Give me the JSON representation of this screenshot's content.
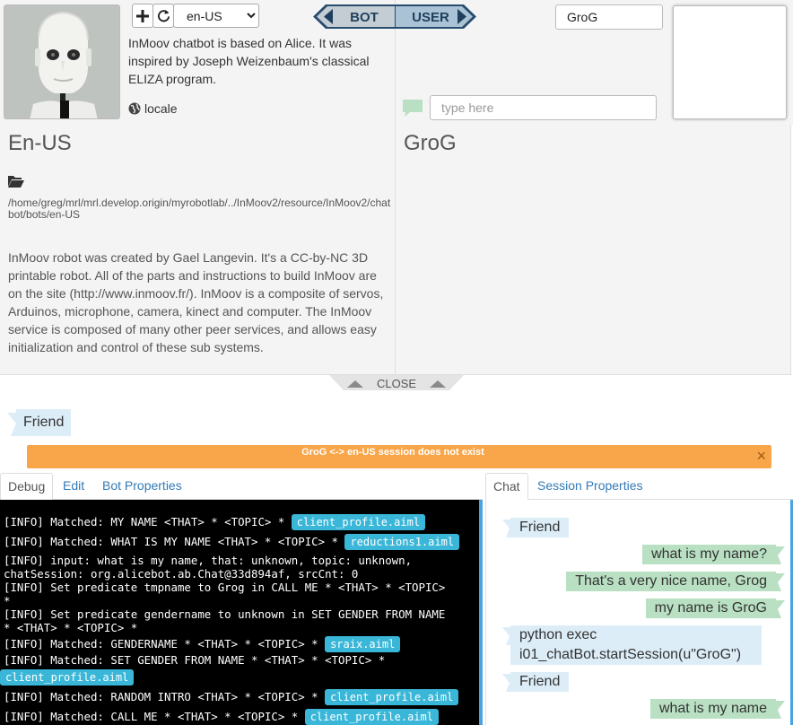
{
  "header": {
    "language_selected": "en-US",
    "bot_description": "InMoov chatbot is based on Alice. It was inspired by Joseph Weizenbaum's classical ELIZA program.",
    "locale_label": "locale",
    "toggle_bot_label": "BOT",
    "toggle_user_label": "USER",
    "user_name_value": "GroG",
    "chat_input_placeholder": "type here"
  },
  "bot_details": {
    "title": "En-US",
    "path": "/home/greg/mrl/mrl.develop.origin/myrobotlab/../InMoov2/resource/InMoov2/chatbot/bots/en-US",
    "about": "InMoov robot was created by Gael Langevin. It's a CC-by-NC 3D printable robot. All of the parts and instructions to build InMoov are on the site (http://www.inmoov.fr/). InMoov is a composite of servos, Arduinos, microphone, camera, kinect and computer. The InMoov service is composed of many other peer services, and allows easy initialization and control of these sub systems."
  },
  "user_details": {
    "title": "GroG"
  },
  "close_label": "CLOSE",
  "friend_tag": "Friend",
  "alert": {
    "text": "GroG <-> en-US session does not exist",
    "close": "×"
  },
  "tabs_left": [
    {
      "label": "Debug"
    },
    {
      "label": "Edit"
    },
    {
      "label": "Bot Properties"
    }
  ],
  "tabs_right": [
    {
      "label": "Chat"
    },
    {
      "label": "Session Properties"
    }
  ],
  "log": [
    {
      "text": "[INFO] Matched: MY NAME <THAT> * <TOPIC> * ",
      "badge": "client_profile.aiml"
    },
    {
      "text": "[INFO] Matched: WHAT IS MY NAME <THAT> * <TOPIC> * ",
      "badge": "reductions1.aiml"
    },
    {
      "text": "[INFO] input: what is my name, that: unknown, topic: unknown,\nchatSession: org.alicebot.ab.Chat@33d894af, srcCnt: 0",
      "badge": ""
    },
    {
      "text": "[INFO] Set predicate tmpname to Grog in CALL ME * <THAT> * <TOPIC>\n*",
      "badge": ""
    },
    {
      "text": "[INFO] Set predicate gendername to unknown in SET GENDER FROM NAME\n* <THAT> * <TOPIC> *",
      "badge": ""
    },
    {
      "text": "[INFO] Matched: GENDERNAME * <THAT> * <TOPIC> * ",
      "badge": "sraix.aiml"
    },
    {
      "text": "[INFO] Matched: SET GENDER FROM NAME * <THAT> * <TOPIC> *",
      "badge": ""
    },
    {
      "text": "",
      "badge": "client_profile.aiml"
    },
    {
      "text": "[INFO] Matched: RANDOM INTRO <THAT> * <TOPIC> * ",
      "badge": "client_profile.aiml"
    },
    {
      "text": "[INFO] Matched: CALL ME * <THAT> * <TOPIC> * ",
      "badge": "client_profile.aiml"
    }
  ],
  "chat_messages": [
    {
      "from": "bot",
      "text": "Friend"
    },
    {
      "from": "user",
      "text": "what is my name?"
    },
    {
      "from": "user",
      "text": "That's a very nice name, Grog"
    },
    {
      "from": "user",
      "text": "my name is GroG"
    },
    {
      "from": "bot",
      "text": "python exec i01_chatBot.startSession(u\"GroG\")"
    },
    {
      "from": "bot",
      "text": "Friend"
    },
    {
      "from": "user",
      "text": "what is my name"
    }
  ],
  "colors": {
    "bot_bubble": "#dcedf8",
    "user_bubble": "#b9e0c3",
    "alert": "#f9a64a",
    "badge": "#3ab7d8",
    "accent": "#4aa3df"
  }
}
